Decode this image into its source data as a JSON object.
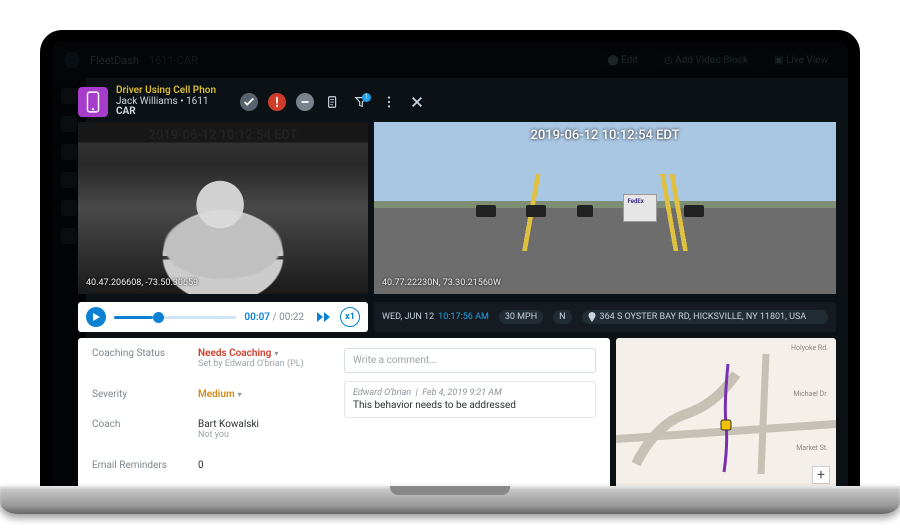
{
  "event": {
    "title": "Driver Using Cell Phon",
    "driver": "Jack Williams",
    "driver_id": "1611",
    "vehicle": "CAR"
  },
  "toolbar": {
    "badge_count": "1"
  },
  "video": {
    "timestamp": "2019-06-12 10:12:54 EDT",
    "cabin_gps": "40.47.206608, -73.50.30659",
    "road_gps": "40.77.22230N, 73.30.21560W",
    "current": "00:07",
    "duration": "00:22",
    "speed_label": "x1"
  },
  "status": {
    "date": "WED, JUN 12",
    "time": "10:17:56 AM",
    "speed": "30 MPH",
    "heading": "N",
    "address": "364 S OYSTER BAY RD, HICKSVILLE, NY 11801, USA"
  },
  "detail": {
    "coaching_status_label": "Coaching Status",
    "coaching_status_value": "Needs Coaching",
    "coaching_status_hint": "Set by Edward O'brian (PL)",
    "severity_label": "Severity",
    "severity_value": "Medium",
    "coach_label": "Coach",
    "coach_value": "Bart Kowalski",
    "coach_hint": "Not you",
    "reminders_label": "Email Reminders",
    "reminders_value": "0"
  },
  "comments": {
    "placeholder": "Write a comment...",
    "items": [
      {
        "author": "Edward O'brian",
        "ts": "Feb 4, 2019 9:21 AM",
        "body": "This behavior needs to be addressed"
      }
    ]
  },
  "map": {
    "streets": [
      "Holyoke Rd.",
      "Market St.",
      "Michael Dr."
    ],
    "zoom_label": "+"
  }
}
